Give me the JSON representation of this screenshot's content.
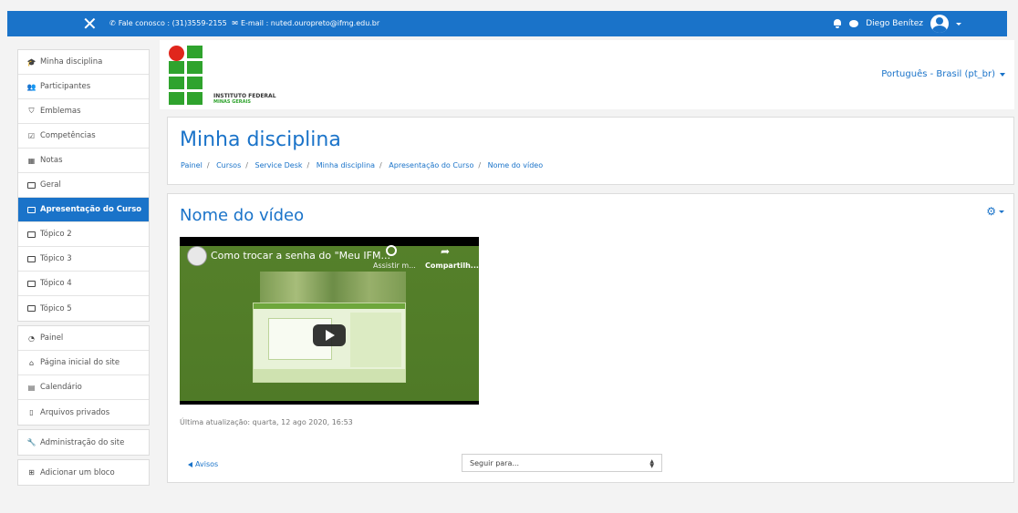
{
  "topbar": {
    "close_glyph": "✕",
    "contact": "Fale conosco : (31)3559-2155",
    "email": "E-mail : nuted.ouropreto@ifmg.edu.br",
    "user_name": "Diego Benítez"
  },
  "sidebar": {
    "groups": [
      [
        {
          "label": "Minha disciplina",
          "icon": "graduation-cap-icon"
        },
        {
          "label": "Participantes",
          "icon": "users-icon"
        },
        {
          "label": "Emblemas",
          "icon": "shield-icon"
        },
        {
          "label": "Competências",
          "icon": "check-square-icon"
        },
        {
          "label": "Notas",
          "icon": "table-icon"
        },
        {
          "label": "Geral",
          "icon": "folder-icon"
        },
        {
          "label": "Apresentação do Curso",
          "icon": "folder-icon",
          "active": true
        },
        {
          "label": "Tópico 2",
          "icon": "folder-icon"
        },
        {
          "label": "Tópico 3",
          "icon": "folder-icon"
        },
        {
          "label": "Tópico 4",
          "icon": "folder-icon"
        },
        {
          "label": "Tópico 5",
          "icon": "folder-icon"
        }
      ],
      [
        {
          "label": "Painel",
          "icon": "dashboard-icon"
        },
        {
          "label": "Página inicial do site",
          "icon": "home-icon"
        },
        {
          "label": "Calendário",
          "icon": "calendar-icon"
        },
        {
          "label": "Arquivos privados",
          "icon": "file-icon"
        }
      ],
      [
        {
          "label": "Administração do site",
          "icon": "wrench-icon"
        }
      ],
      [
        {
          "label": "Adicionar um bloco",
          "icon": "plus-square-icon"
        }
      ]
    ]
  },
  "header": {
    "logo_line1": "INSTITUTO FEDERAL",
    "logo_line2": "MINAS GERAIS",
    "language": "Português - Brasil (pt_br)"
  },
  "course": {
    "title": "Minha disciplina",
    "breadcrumb": [
      "Painel",
      "Cursos",
      "Service Desk",
      "Minha disciplina",
      "Apresentação do Curso",
      "Nome do vídeo"
    ]
  },
  "main": {
    "title": "Nome do vídeo",
    "video_title": "Como trocar a senha do \"Meu IFM...",
    "video_watch": "Assistir m...",
    "video_share": "Compartilh...",
    "updated": "Última atualização: quarta, 12 ago 2020, 16:53",
    "prev_link": "Avisos",
    "jump_placeholder": "Seguir para..."
  },
  "colors": {
    "accent": "#1a73c9",
    "logo_green": "#2fa32d",
    "logo_red": "#e0261c"
  }
}
